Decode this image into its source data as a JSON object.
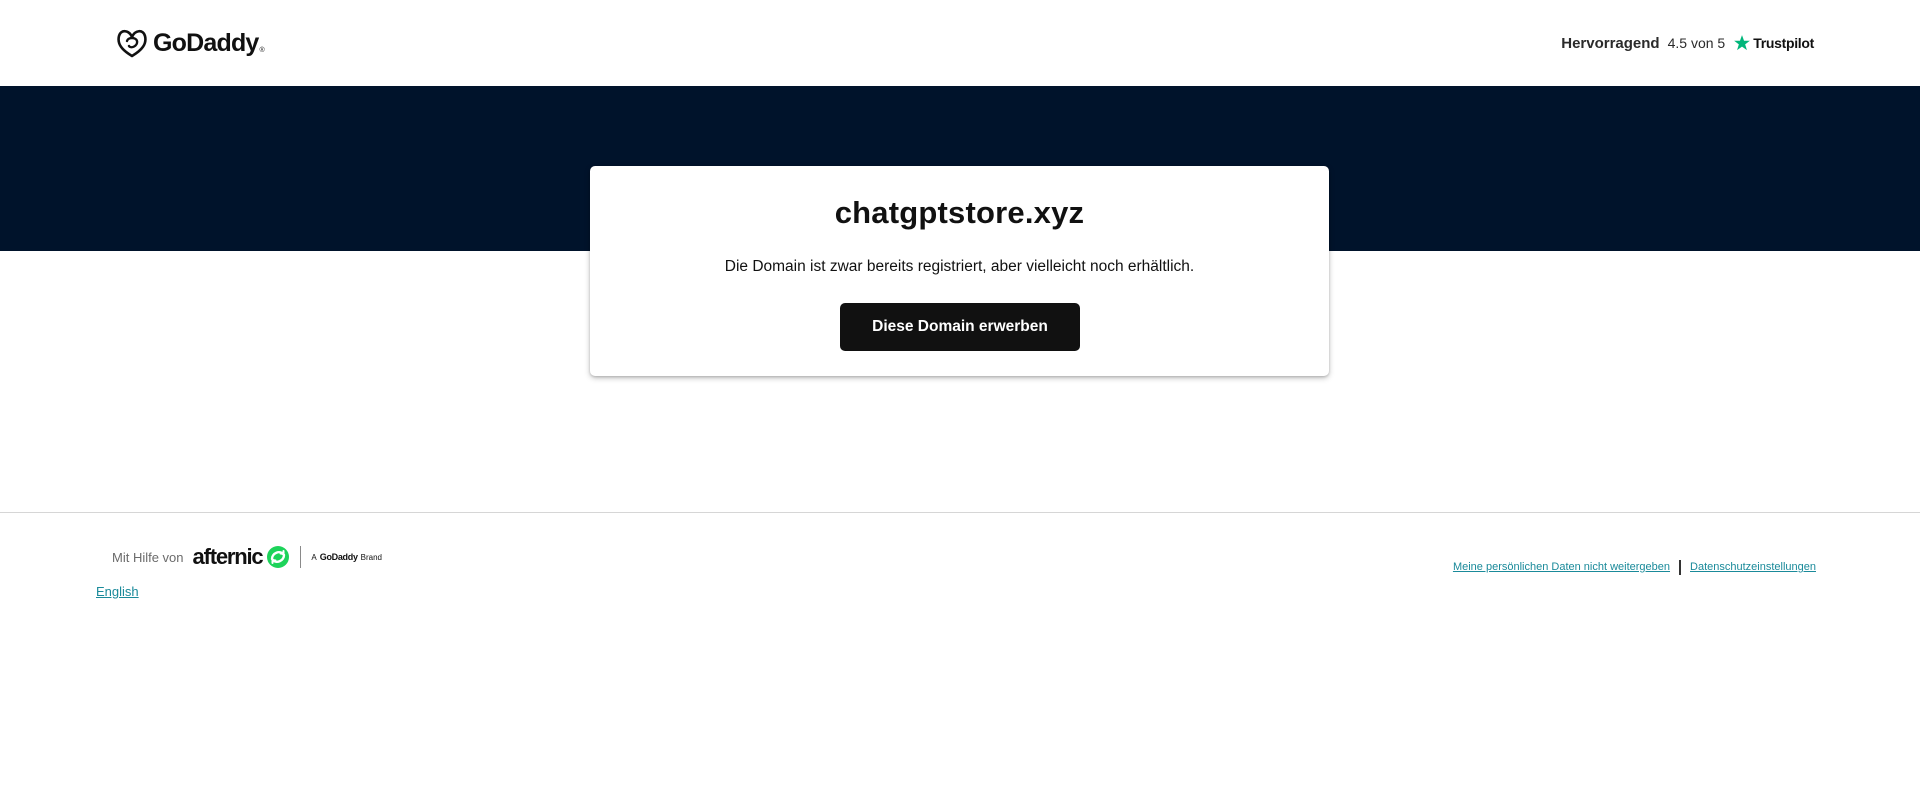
{
  "header": {
    "logo_text": "GoDaddy",
    "logo_tm": "®",
    "trust_rating_word": "Hervorragend",
    "trust_score": "4.5 von 5",
    "trust_brand": "Trustpilot"
  },
  "card": {
    "domain": "chatgptstore.xyz",
    "message": "Die Domain ist zwar bereits registriert, aber vielleicht noch erhältlich.",
    "button_label": "Diese Domain erwerben"
  },
  "footer": {
    "powered_by_label": "Mit Hilfe von",
    "partner_name": "afternic",
    "brand_tag_prefix": "A",
    "brand_tag_name": "GoDaddy",
    "brand_tag_suffix": "Brand",
    "language_link": "English",
    "legal_links": [
      "Meine persönlichen Daten nicht weitergeben",
      "Datenschutzeinstellungen"
    ]
  },
  "colors": {
    "band": "#00132b",
    "button": "#111111",
    "link": "#1a8a9a",
    "trustpilot_star": "#00b67a",
    "afternic_green": "#1dd35a"
  }
}
